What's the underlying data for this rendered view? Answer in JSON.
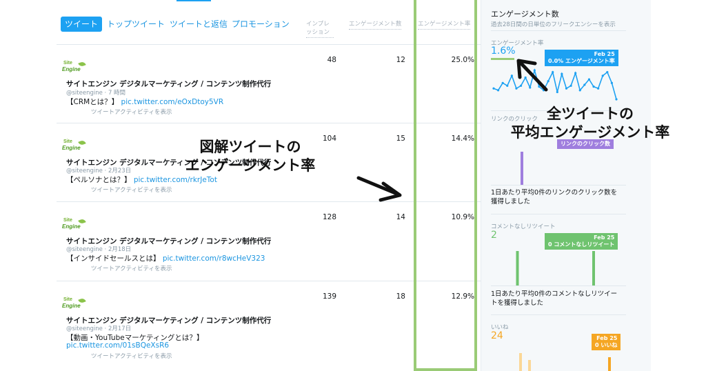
{
  "tabs": [
    {
      "label": "ツイート",
      "active": true
    },
    {
      "label": "トップツイート"
    },
    {
      "label": "ツイートと返信"
    },
    {
      "label": "プロモーション"
    }
  ],
  "columns": {
    "impressions": "インプレッション",
    "engagements": "エンゲージメント数",
    "rate": "エンゲージメント率"
  },
  "tweets": [
    {
      "account": "サイトエンジン デジタルマーケティング / コンテンツ制作代行",
      "meta": "@siteengine · 7 時間",
      "text": "【CRMとは？】",
      "link": "pic.twitter.com/eOxDtoy5VR",
      "activity": "ツイートアクティビティを表示",
      "impressions": "48",
      "engagements": "12",
      "rate": "25.0%"
    },
    {
      "account": "サイトエンジン デジタルマーケティング / コンテンツ制作代行",
      "meta": "@siteengine · 2月23日",
      "text": "【ペルソナとは？】",
      "link": "pic.twitter.com/rkrJeTot",
      "activity": "ツイートアクティビティを表示",
      "impressions": "104",
      "engagements": "15",
      "rate": "14.4%"
    },
    {
      "account": "サイトエンジン デジタルマーケティング / コンテンツ制作代行",
      "meta": "@siteengine · 2月18日",
      "text": "【インサイドセールスとは】",
      "link": "pic.twitter.com/r8wcHeV323",
      "activity": "ツイートアクティビティを表示",
      "impressions": "128",
      "engagements": "14",
      "rate": "10.9%"
    },
    {
      "account": "サイトエンジン デジタルマーケティング / コンテンツ制作代行",
      "meta": "@siteengine · 2月17日",
      "text": "【動画・YouTubeマーケティングとは？】",
      "link": "pic.twitter.com/01sBQeXsR6",
      "activity": "ツイートアクティビティを表示",
      "impressions": "139",
      "engagements": "18",
      "rate": "12.9%"
    }
  ],
  "logo": {
    "line1": "Site",
    "line2": "Engine"
  },
  "sidebar": {
    "title": "エンゲージメント数",
    "subtitle": "過去28日間の日単位のフリークエンシーを表示",
    "rate": {
      "label": "エンゲージメント率",
      "value": "1.6%",
      "tip_date": "Feb 25",
      "tip_text": "0.0% エンゲージメント率",
      "color": "#1da1f2",
      "chart_data": {
        "type": "line",
        "values": [
          1.2,
          1.0,
          1.8,
          1.5,
          2.6,
          1.2,
          1.5,
          2.4,
          1.3,
          3.2,
          1.4,
          1.0,
          2.0,
          3.0,
          0.8,
          2.8,
          1.2,
          1.5,
          2.9,
          1.0,
          1.6,
          2.2,
          1.4,
          1.2,
          2.6,
          3.0,
          1.8,
          0.0
        ]
      }
    },
    "clicks": {
      "label": "リンクのクリック",
      "tip_text": "リンクのクリック数",
      "desc": "1日あたり平均0件のリンクのクリック数を獲得しました",
      "color": "#9f7ede",
      "chart_data": {
        "type": "bar",
        "values": [
          0,
          0,
          0,
          0,
          0,
          0,
          1,
          0,
          0,
          0,
          0,
          0,
          0,
          0,
          0,
          0,
          0,
          0,
          0,
          0,
          0,
          0,
          0,
          0,
          0,
          0,
          0,
          0
        ]
      }
    },
    "retweets": {
      "label": "コメントなしリツイート",
      "value": "2",
      "tip_date": "Feb 25",
      "tip_text": "0 コメントなしリツイート",
      "desc": "1日あたり平均0件のコメントなしリツイートを獲得しました",
      "color": "#6fc36f",
      "chart_data": {
        "type": "bar",
        "values": [
          0,
          0,
          0,
          0,
          0,
          1,
          0,
          0,
          0,
          0,
          0,
          0,
          0,
          0,
          0,
          0,
          0,
          0,
          0,
          0,
          0,
          0,
          1,
          0,
          0,
          0,
          0,
          0
        ]
      }
    },
    "likes": {
      "label": "いいね",
      "value": "24",
      "tip_date": "Feb 25",
      "tip_text": "0 いいね",
      "color": "#f5a623"
    }
  },
  "annotations": {
    "left_line1": "図解ツイートの",
    "left_line2": "エンゲージメント率",
    "right_line1": "全ツイートの",
    "right_line2": "平均エンゲージメント率"
  }
}
